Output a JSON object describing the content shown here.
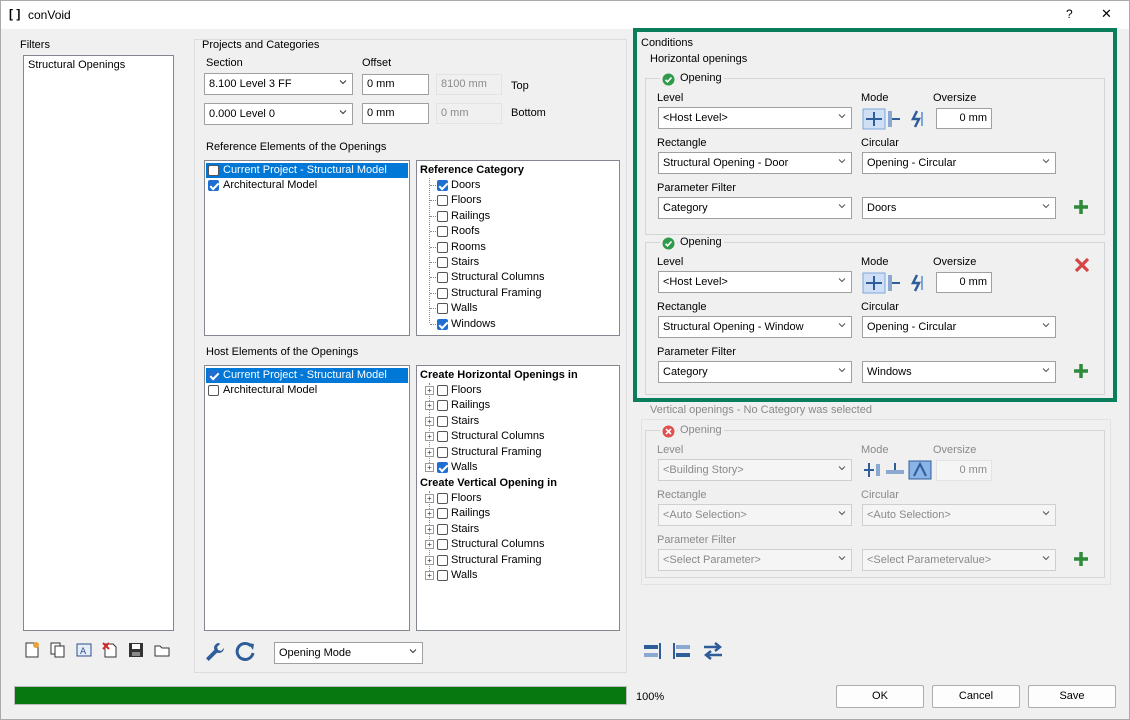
{
  "window": {
    "title": "conVoid",
    "help": "?",
    "close": "✕"
  },
  "filters": {
    "header": "Filters",
    "items": [
      "Structural Openings"
    ]
  },
  "projects": {
    "header": "Projects and Categories",
    "section_label": "Section",
    "offset_label": "Offset",
    "top_level": "8.100  Level 3 FF",
    "top_offset": "0 mm",
    "top_readonly": "8100 mm",
    "top_label": "Top",
    "bottom_level": "0.000  Level 0",
    "bottom_offset": "0 mm",
    "bottom_readonly": "0 mm",
    "bottom_label": "Bottom"
  },
  "reference": {
    "header": "Reference Elements of the Openings",
    "models": [
      {
        "label": "Current Project - Structural Model",
        "checked": false,
        "selected": true
      },
      {
        "label": "Architectural Model",
        "checked": true,
        "selected": false
      }
    ],
    "category_header": "Reference Category",
    "categories": [
      {
        "label": "Doors",
        "checked": true
      },
      {
        "label": "Floors",
        "checked": false
      },
      {
        "label": "Railings",
        "checked": false
      },
      {
        "label": "Roofs",
        "checked": false
      },
      {
        "label": "Rooms",
        "checked": false
      },
      {
        "label": "Stairs",
        "checked": false
      },
      {
        "label": "Structural Columns",
        "checked": false
      },
      {
        "label": "Structural Framing",
        "checked": false
      },
      {
        "label": "Walls",
        "checked": false
      },
      {
        "label": "Windows",
        "checked": true
      }
    ]
  },
  "host": {
    "header": "Host Elements of the Openings",
    "models": [
      {
        "label": "Current Project - Structural Model",
        "checked": true,
        "selected": true
      },
      {
        "label": "Architectural Model",
        "checked": false,
        "selected": false
      }
    ],
    "horizontal_header": "Create Horizontal Openings in",
    "horizontal": [
      {
        "label": "Floors",
        "checked": false
      },
      {
        "label": "Railings",
        "checked": false
      },
      {
        "label": "Stairs",
        "checked": false
      },
      {
        "label": "Structural Columns",
        "checked": false
      },
      {
        "label": "Structural Framing",
        "checked": false
      },
      {
        "label": "Walls",
        "checked": true
      }
    ],
    "vertical_header": "Create Vertical Opening in",
    "vertical": [
      {
        "label": "Floors",
        "checked": false
      },
      {
        "label": "Railings",
        "checked": false
      },
      {
        "label": "Stairs",
        "checked": false
      },
      {
        "label": "Structural Columns",
        "checked": false
      },
      {
        "label": "Structural Framing",
        "checked": false
      },
      {
        "label": "Walls",
        "checked": false
      }
    ]
  },
  "mode_combo": "Opening Mode",
  "conditions": {
    "header": "Conditions",
    "horizontal_header": "Horizontal openings",
    "opening1": {
      "title": "Opening",
      "level_label": "Level",
      "mode_label": "Mode",
      "oversize_label": "Oversize",
      "level": "<Host Level>",
      "oversize": "0 mm",
      "rect_label": "Rectangle",
      "circ_label": "Circular",
      "rect": "Structural Opening - Door",
      "circ": "Opening - Circular",
      "param_label": "Parameter Filter",
      "param": "Category",
      "param_value": "Doors"
    },
    "opening2": {
      "title": "Opening",
      "level_label": "Level",
      "mode_label": "Mode",
      "oversize_label": "Oversize",
      "level": "<Host Level>",
      "oversize": "0 mm",
      "rect_label": "Rectangle",
      "circ_label": "Circular",
      "rect": "Structural Opening - Window",
      "circ": "Opening - Circular",
      "param_label": "Parameter Filter",
      "param": "Category",
      "param_value": "Windows"
    },
    "vertical_header": "Vertical openings - No Category was selected",
    "opening3": {
      "title": "Opening",
      "level_label": "Level",
      "mode_label": "Mode",
      "oversize_label": "Oversize",
      "level": "<Building Story>",
      "oversize": "0 mm",
      "rect_label": "Rectangle",
      "circ_label": "Circular",
      "rect": "<Auto Selection>",
      "circ": "<Auto Selection>",
      "param_label": "Parameter Filter",
      "param": "<Select Parameter>",
      "param_value": "<Select Parametervalue>"
    }
  },
  "progress": {
    "value": 1.0,
    "label": "100%"
  },
  "buttons": {
    "ok": "OK",
    "cancel": "Cancel",
    "save": "Save"
  },
  "colors": {
    "accent": "#0078d7",
    "progress": "#06780f",
    "highlight": "#0a7d5a",
    "add": "#2e8b3a",
    "remove": "#d64545"
  }
}
